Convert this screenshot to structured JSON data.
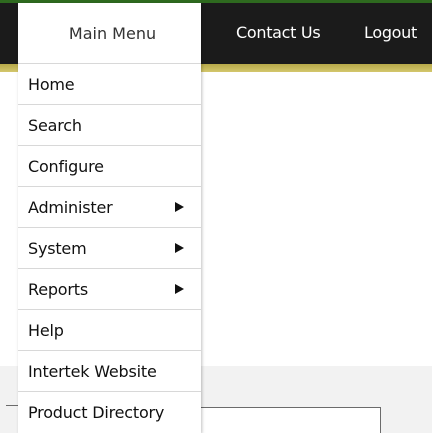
{
  "header": {
    "menu_title": "Main Menu",
    "contact_label": "Contact Us",
    "logout_label": "Logout"
  },
  "menu": {
    "items": [
      {
        "label": "Home",
        "has_submenu": false
      },
      {
        "label": "Search",
        "has_submenu": false
      },
      {
        "label": "Configure",
        "has_submenu": false
      },
      {
        "label": "Administer",
        "has_submenu": true
      },
      {
        "label": "System",
        "has_submenu": true
      },
      {
        "label": "Reports",
        "has_submenu": true
      },
      {
        "label": "Help",
        "has_submenu": false
      },
      {
        "label": "Intertek Website",
        "has_submenu": false
      },
      {
        "label": "Product Directory",
        "has_submenu": false
      }
    ],
    "submenu_icon": "triangle-right-icon"
  },
  "colors": {
    "topbar": "#1b1b1b",
    "accent_bar": "#c9bb5c",
    "top_edge": "#2e6a1f",
    "menu_background": "#ffffff",
    "divider": "#d8d8d8"
  }
}
